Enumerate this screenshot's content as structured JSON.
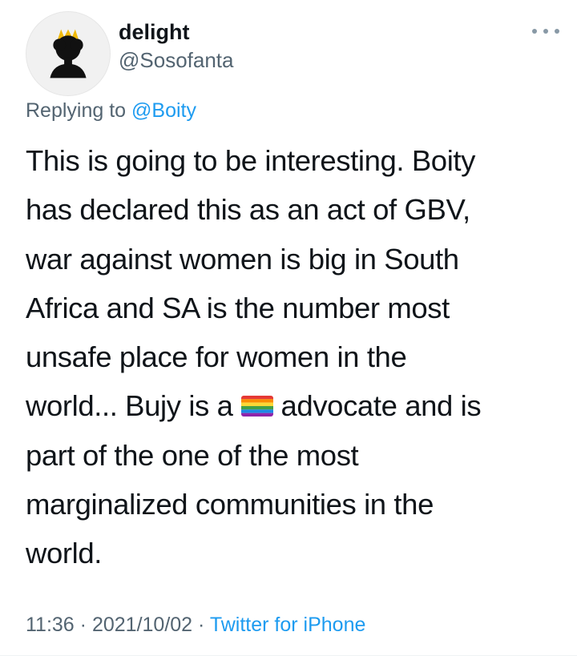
{
  "tweet": {
    "author": {
      "display_name": "delight",
      "handle": "@Sosofanta"
    },
    "more_options_icon": "ellipsis-icon",
    "reply_context": {
      "prefix": "Replying to ",
      "mention": "@Boity"
    },
    "text_lines": [
      "This is going to be interesting. Boity",
      "has declared this as an act of GBV,",
      "war against women is big in South",
      "Africa and SA is the number most",
      "unsafe place for women in the",
      "world... Bujy is a",
      "advocate and is",
      "part of the one of the most",
      "marginalized communities in the",
      "world."
    ],
    "emoji": "rainbow-flag",
    "meta": {
      "time": "11:36",
      "separator": "·",
      "date": "2021/10/02",
      "source": "Twitter for iPhone"
    }
  }
}
